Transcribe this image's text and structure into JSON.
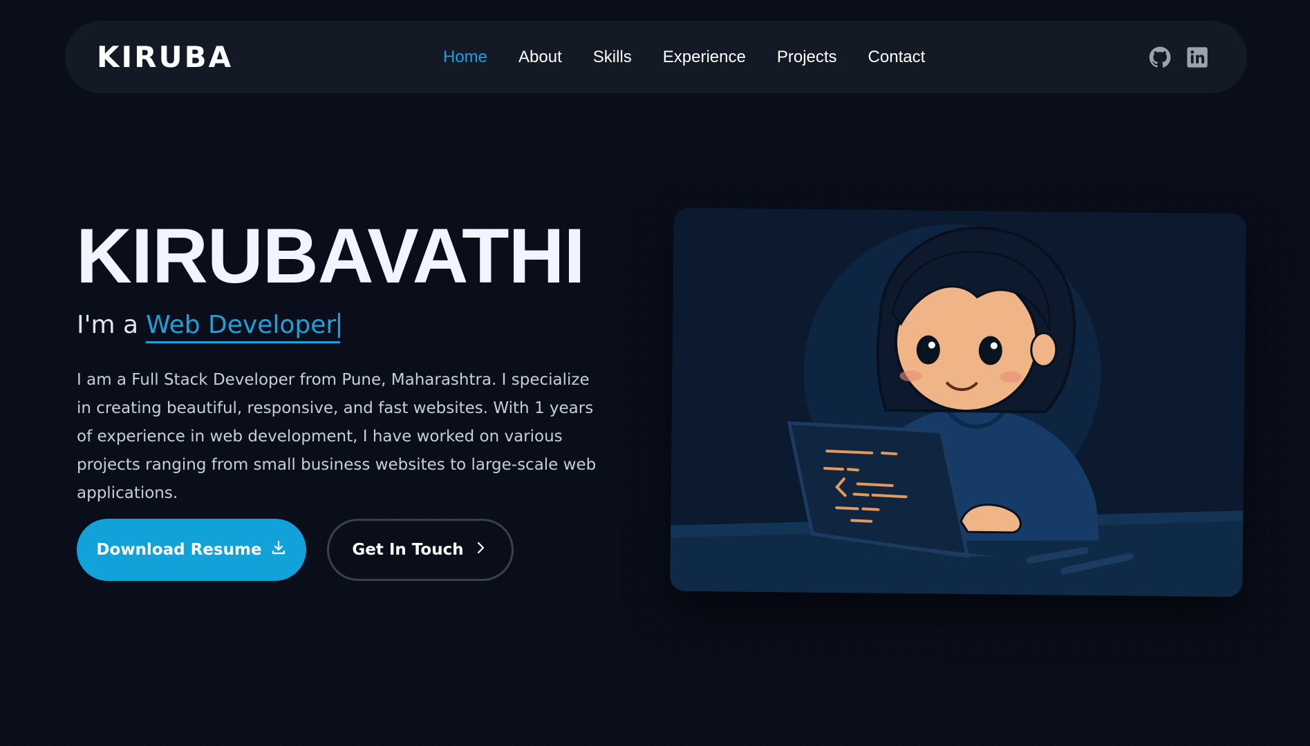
{
  "nav": {
    "logo": "KIRUBA",
    "links": [
      {
        "label": "Home",
        "active": true
      },
      {
        "label": "About",
        "active": false
      },
      {
        "label": "Skills",
        "active": false
      },
      {
        "label": "Experience",
        "active": false
      },
      {
        "label": "Projects",
        "active": false
      },
      {
        "label": "Contact",
        "active": false
      }
    ],
    "icons": [
      "github-icon",
      "linkedin-icon"
    ]
  },
  "hero": {
    "name": "KIRUBAVATHI",
    "subtitle_prefix": "I'm a",
    "role": "Web Developer",
    "intro": "I am a Full Stack Developer from Pune, Maharashtra. I specialize in creating beautiful, responsive, and fast websites. With 1 years of experience in web development, I have worked on various projects ranging from small business websites to large-scale web applications.",
    "buttons": {
      "primary": "Download Resume",
      "secondary": "Get In Touch"
    }
  },
  "colors": {
    "background": "#090e1a",
    "navbar": "#141a25",
    "accent": "#1ea1db",
    "button_primary": "#12a2da"
  }
}
